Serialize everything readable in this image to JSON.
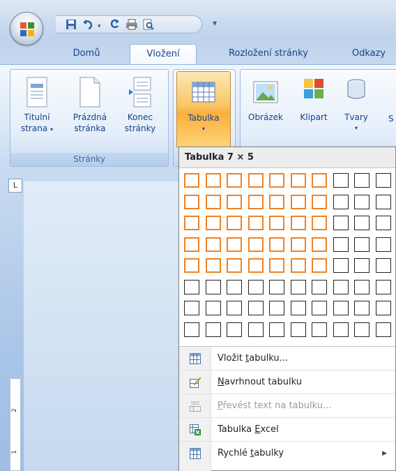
{
  "qat": {
    "icons": [
      "save-icon",
      "undo-icon",
      "redo-icon",
      "print-icon",
      "print-preview-icon"
    ],
    "customize": "▾"
  },
  "tabs": [
    {
      "label": "Domů",
      "active": false
    },
    {
      "label": "Vložení",
      "active": true
    },
    {
      "label": "Rozložení stránky",
      "active": false
    },
    {
      "label": "Odkazy",
      "active": false
    }
  ],
  "ribbon": {
    "pages_group": {
      "title": "Stránky",
      "buttons": [
        {
          "line1": "Titulní",
          "line2": "strana"
        },
        {
          "line1": "Prázdná",
          "line2": "stránka"
        },
        {
          "line1": "Konec",
          "line2": "stránky"
        }
      ]
    },
    "table_group": {
      "label": "Tabulka"
    },
    "illustrations": {
      "buttons": [
        {
          "label": "Obrázek"
        },
        {
          "label": "Klipart"
        },
        {
          "label": "Tvary"
        },
        {
          "label": "S"
        }
      ]
    }
  },
  "ruler": {
    "corner": "L",
    "marks": [
      "2",
      "1"
    ]
  },
  "table_dropdown": {
    "header": "Tabulka 7 × 5",
    "grid": {
      "columns": 10,
      "rows": 8,
      "selected_columns": 7,
      "selected_rows": 5
    },
    "menu": [
      {
        "before": "Vložit ",
        "accel": "t",
        "after": "abulku...",
        "icon": "insert-table-icon",
        "disabled": false,
        "submenu": false
      },
      {
        "before": "",
        "accel": "N",
        "after": "avrhnout tabulku",
        "icon": "draw-table-icon",
        "disabled": false,
        "submenu": false
      },
      {
        "before": "",
        "accel": "P",
        "after": "řevést text na tabulku...",
        "icon": "convert-text-icon",
        "disabled": true,
        "submenu": false
      },
      {
        "before": "Tabulka ",
        "accel": "E",
        "after": "xcel",
        "icon": "excel-table-icon",
        "disabled": false,
        "submenu": false
      },
      {
        "before": "Rychlé ",
        "accel": "t",
        "after": "abulky",
        "icon": "quick-tables-icon",
        "disabled": false,
        "submenu": true
      }
    ]
  },
  "colors": {
    "highlight": "#f08224",
    "pressed": "#fbaf3b",
    "ribbon_text": "#15428b"
  }
}
